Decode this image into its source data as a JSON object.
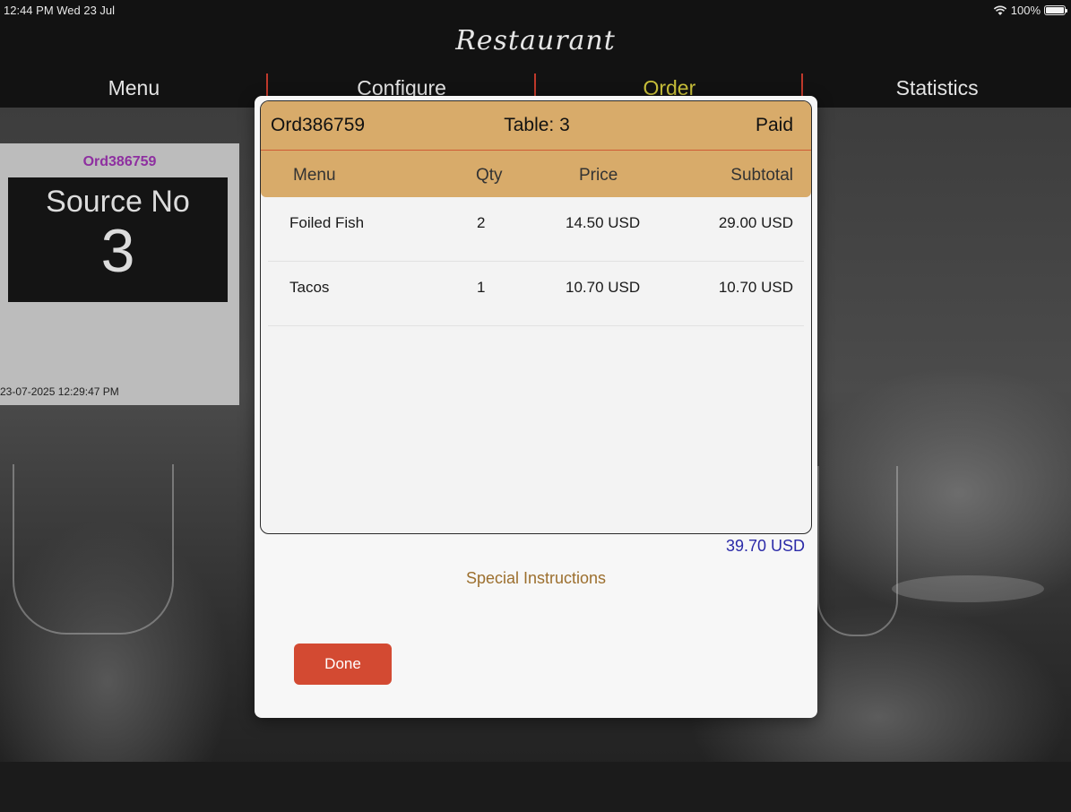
{
  "status_bar": {
    "time": "12:44 PM  Wed 23 Jul",
    "battery": "100%",
    "battery_level": 1.0
  },
  "app": {
    "title": "Restaurant"
  },
  "nav": {
    "tabs": [
      {
        "label": "Menu",
        "active": false
      },
      {
        "label": "Configure",
        "active": false
      },
      {
        "label": "Order",
        "active": true
      },
      {
        "label": "Statistics",
        "active": false
      }
    ],
    "active_color": "#c9c03a",
    "separator_color": "#c0392b"
  },
  "source_card": {
    "order_id": "Ord386759",
    "label": "Source No",
    "number": "3",
    "datetime": "23-07-2025 12:29:47 PM"
  },
  "order": {
    "id": "Ord386759",
    "table": "Table: 3",
    "status": "Paid",
    "columns": [
      "Menu",
      "Qty",
      "Price",
      "Subtotal"
    ],
    "items": [
      {
        "menu": "Foiled Fish",
        "qty": "2",
        "price": "14.50 USD",
        "subtotal": "29.00 USD"
      },
      {
        "menu": "Tacos",
        "qty": "1",
        "price": "10.70 USD",
        "subtotal": "10.70 USD"
      }
    ],
    "total": "39.70 USD",
    "special_instructions_label": "Special Instructions",
    "done_label": "Done",
    "header_color": "#d8ab6a",
    "done_color": "#d34a32"
  }
}
